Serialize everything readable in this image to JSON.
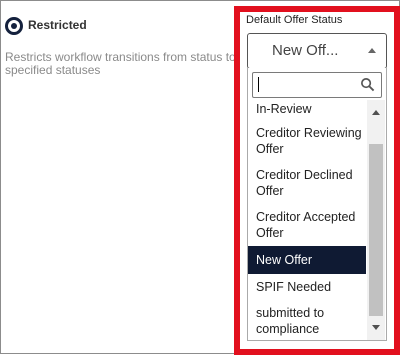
{
  "option": {
    "label": "Restricted",
    "description": "Restricts workflow transitions from status to specified statuses",
    "selected": true
  },
  "default_offer_status": {
    "label": "Default Offer Status",
    "value": "New Off...",
    "search_placeholder": "",
    "items": [
      {
        "label": "In-Review",
        "selected": false
      },
      {
        "label": "Creditor Reviewing Offer",
        "selected": false
      },
      {
        "label": "Creditor Declined Offer",
        "selected": false
      },
      {
        "label": "Creditor Accepted Offer",
        "selected": false
      },
      {
        "label": "New Offer",
        "selected": true
      },
      {
        "label": "SPIF Needed",
        "selected": false
      },
      {
        "label": "submitted to compliance",
        "selected": false
      }
    ]
  },
  "colors": {
    "highlight": "#e2101e",
    "selected_bg": "#0f1a33"
  },
  "icons": {
    "radio": "radio-selected-icon",
    "dropdown": "caret-up-icon",
    "search": "search-icon"
  }
}
